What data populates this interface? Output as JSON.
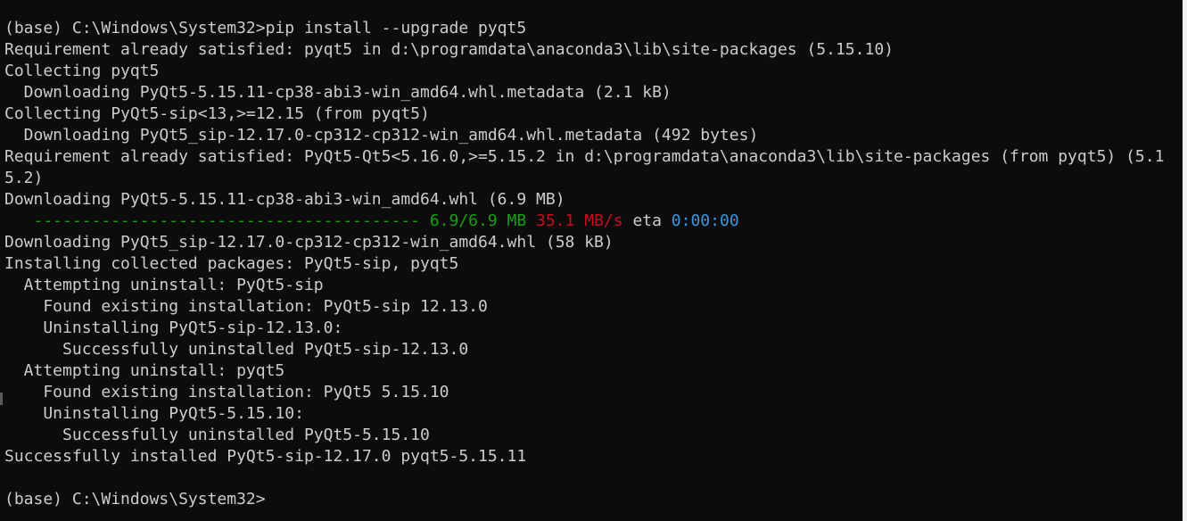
{
  "terminal": {
    "lines": [
      "(base) C:\\Windows\\System32>pip install --upgrade pyqt5",
      "Requirement already satisfied: pyqt5 in d:\\programdata\\anaconda3\\lib\\site-packages (5.15.10)",
      "Collecting pyqt5",
      "  Downloading PyQt5-5.15.11-cp38-abi3-win_amd64.whl.metadata (2.1 kB)",
      "Collecting PyQt5-sip<13,>=12.15 (from pyqt5)",
      "  Downloading PyQt5_sip-12.17.0-cp312-cp312-win_amd64.whl.metadata (492 bytes)",
      "Requirement already satisfied: PyQt5-Qt5<5.16.0,>=5.15.2 in d:\\programdata\\anaconda3\\lib\\site-packages (from pyqt5) (5.1",
      "5.2)",
      "Downloading PyQt5-5.15.11-cp38-abi3-win_amd64.whl (6.9 MB)"
    ],
    "progress": {
      "bar": "   ---------------------------------------- ",
      "size": "6.9/6.9 MB",
      "speed": "35.1 MB/s",
      "eta_label": "eta",
      "eta": "0:00:00",
      "fraction": 1.0
    },
    "lines_after": [
      "Downloading PyQt5_sip-12.17.0-cp312-cp312-win_amd64.whl (58 kB)",
      "Installing collected packages: PyQt5-sip, pyqt5",
      "  Attempting uninstall: PyQt5-sip",
      "    Found existing installation: PyQt5-sip 12.13.0",
      "    Uninstalling PyQt5-sip-12.13.0:",
      "      Successfully uninstalled PyQt5-sip-12.13.0",
      "  Attempting uninstall: pyqt5",
      "    Found existing installation: PyQt5 5.15.10",
      "    Uninstalling PyQt5-5.15.10:",
      "      Successfully uninstalled PyQt5-5.15.10",
      "Successfully installed PyQt5-sip-12.17.0 pyqt5-5.15.11",
      "",
      "(base) C:\\Windows\\System32>"
    ],
    "colors": {
      "background": "#0c0c0c",
      "foreground": "#cccccc",
      "green": "#13a10e",
      "red": "#c50f1f",
      "blue": "#3a96dd"
    }
  }
}
